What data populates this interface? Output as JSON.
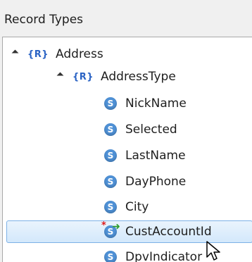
{
  "panel": {
    "title": "Record Types"
  },
  "tree": {
    "root": {
      "badge": "{R}",
      "label": "Address"
    },
    "child": {
      "badge": "{R}",
      "label": "AddressType"
    },
    "fields": [
      {
        "label": "NickName",
        "icon": "s-field-icon"
      },
      {
        "label": "Selected",
        "icon": "s-field-icon"
      },
      {
        "label": "LastName",
        "icon": "s-field-icon"
      },
      {
        "label": "DayPhone",
        "icon": "s-field-icon"
      },
      {
        "label": "City",
        "icon": "s-field-icon"
      },
      {
        "label": "CustAccountId",
        "icon": "s-field-new-icon",
        "selected": true
      },
      {
        "label": "DpvIndicator",
        "icon": "s-field-icon"
      }
    ]
  },
  "colors": {
    "selection_border": "#7db1e6",
    "field_icon": "#4f91d6",
    "record_badge": "#2a63c4"
  }
}
